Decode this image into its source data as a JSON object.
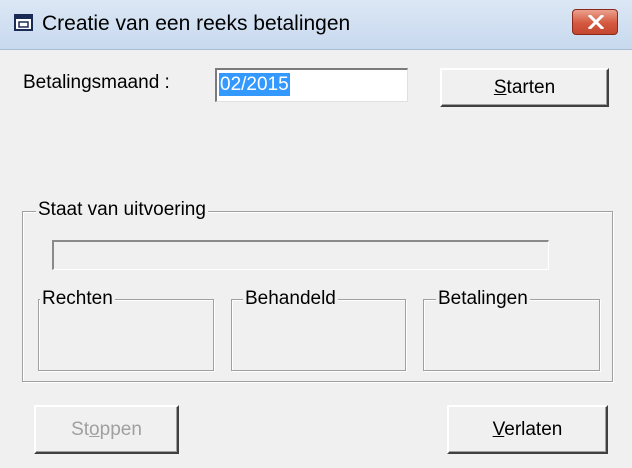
{
  "window": {
    "title": "Creatie van een reeks betalingen",
    "close_icon": "close-icon",
    "app_icon": "window-icon"
  },
  "form": {
    "month_label": "Betalingsmaand :",
    "month_value": "02/2015",
    "start_button": {
      "mnemonic": "S",
      "rest": "tarten"
    }
  },
  "status": {
    "group_title": "Staat van uitvoering",
    "progress": 0,
    "boxes": {
      "rights": "Rechten",
      "processed": "Behandeld",
      "payments": "Betalingen"
    }
  },
  "footer": {
    "stop_button": {
      "prefix": "St",
      "mnemonic": "o",
      "rest": "ppen"
    },
    "exit_button": {
      "mnemonic": "V",
      "rest": "erlaten"
    }
  }
}
